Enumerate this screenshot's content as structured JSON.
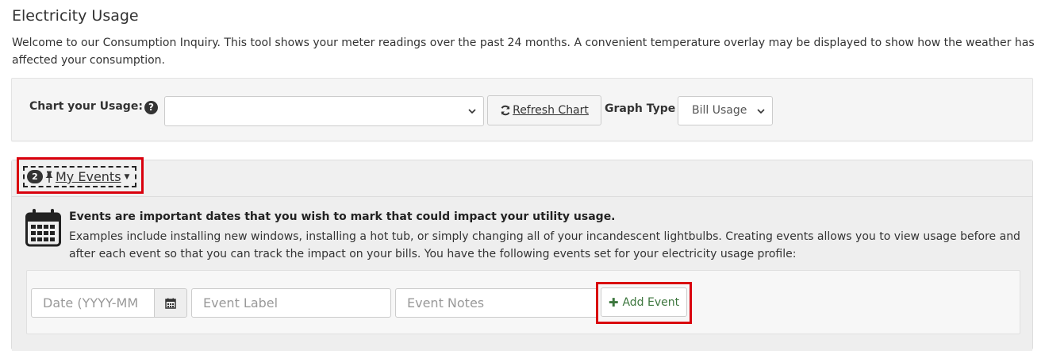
{
  "page": {
    "title": "Electricity Usage",
    "intro": "Welcome to our Consumption Inquiry. This tool shows your meter readings over the past 24 months. A convenient temperature overlay may be displayed to show how the weather has affected your consumption."
  },
  "chart_controls": {
    "label": "Chart your Usage:",
    "help_icon": "question-circle-icon",
    "usage_select_value": "",
    "refresh_label": "Refresh Chart",
    "refresh_icon": "refresh-icon",
    "graph_type_label": "Graph Type",
    "graph_type_value": "Bill Usage"
  },
  "events": {
    "badge_count": "2",
    "pin_icon": "pushpin-icon",
    "toggle_label": "My Events",
    "info_title": "Events are important dates that you wish to mark that could impact your utility usage.",
    "info_text": "Examples include installing new windows, installing a hot tub, or simply changing all of your incandescent lightbulbs. Creating events allows you to view usage before and after each event so that you can track the impact on your bills. You have the following events set for your electricity usage profile:",
    "form": {
      "date_placeholder": "Date (YYYY-MM",
      "label_placeholder": "Event Label",
      "notes_placeholder": "Event Notes",
      "add_label": "Add Event"
    }
  },
  "colors": {
    "highlight": "#d9000d",
    "add_text": "#3c763d",
    "panel_bg": "#f5f5f5"
  }
}
